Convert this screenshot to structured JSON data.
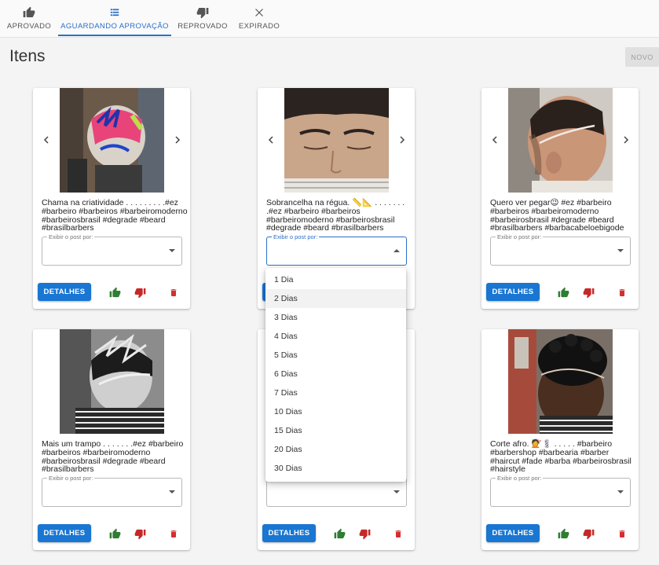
{
  "tabs": [
    {
      "label": "APROVADO",
      "icon": "thumb-up-icon"
    },
    {
      "label": "AGUARDANDO APROVAÇÃO",
      "icon": "list-icon"
    },
    {
      "label": "REPROVADO",
      "icon": "thumb-down-icon"
    },
    {
      "label": "EXPIRADO",
      "icon": "close-icon"
    }
  ],
  "active_tab": "AGUARDANDO APROVAÇÃO",
  "page": {
    "title": "Itens",
    "new_button": "NOVO"
  },
  "select_label": "Exibir o post por:",
  "details_label": "DETALHES",
  "colors": {
    "accent": "#1976d2",
    "approve": "#2e7d32",
    "reject": "#c62828",
    "delete": "#d32f2f"
  },
  "cards": [
    {
      "caption": "Chama na criatividade . . . . . . . . .#ez #barbeiro #barbeiros #barbeiromoderno #barbeirosbrasil #degrade #beard #brasilbarbers"
    },
    {
      "caption": "Sobrancelha na régua. 📏📐 . . . . . . . .#ez #barbeiro #barbeiros #barbeiromoderno #barbeirosbrasil #degrade #beard #brasilbarbers"
    },
    {
      "caption": "Quero ver pegar😉 #ez #barbeiro #barbeiros #barbeiromoderno #barbeirosbrasil #degrade #beard #brasilbarbers #barbacabeloebigode"
    },
    {
      "caption": "Mais um trampo . . . . . . .#ez #barbeiro #barbeiros #barbeiromoderno #barbeirosbrasil #degrade #beard #brasilbarbers"
    },
    {
      "caption": ""
    },
    {
      "caption": "Corte afro. 💇💈 . . . . . #barbeiro #barbershop #barbearia #barber #haircut #fade #barba #barbeirosbrasil #hairstyle"
    }
  ],
  "dropdown_options": [
    "1 Dia",
    "2 Dias",
    "3 Dias",
    "4 Dias",
    "5 Dias",
    "6 Dias",
    "7 Dias",
    "10 Dias",
    "15 Dias",
    "20 Dias",
    "30 Dias"
  ],
  "dropdown_highlighted": "2 Dias"
}
